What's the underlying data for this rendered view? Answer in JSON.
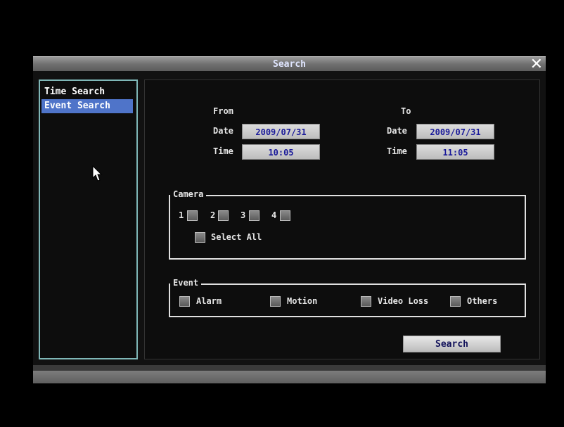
{
  "window": {
    "title": "Search"
  },
  "sidebar": {
    "items": [
      {
        "label": "Time Search",
        "active": false
      },
      {
        "label": "Event Search",
        "active": true
      }
    ]
  },
  "from": {
    "heading": "From",
    "date_label": "Date",
    "date_value": "2009/07/31",
    "time_label": "Time",
    "time_value": "10:05"
  },
  "to": {
    "heading": "To",
    "date_label": "Date",
    "date_value": "2009/07/31",
    "time_label": "Time",
    "time_value": "11:05"
  },
  "camera": {
    "legend": "Camera",
    "channels": [
      "1",
      "2",
      "3",
      "4"
    ],
    "select_all": "Select All"
  },
  "event": {
    "legend": "Event",
    "options": [
      "Alarm",
      "Motion",
      "Video Loss",
      "Others"
    ]
  },
  "search_button": "Search",
  "colors": {
    "highlight": "#4f74c9",
    "panel": "#0d0d0d",
    "field_text": "#1a1a9a"
  }
}
